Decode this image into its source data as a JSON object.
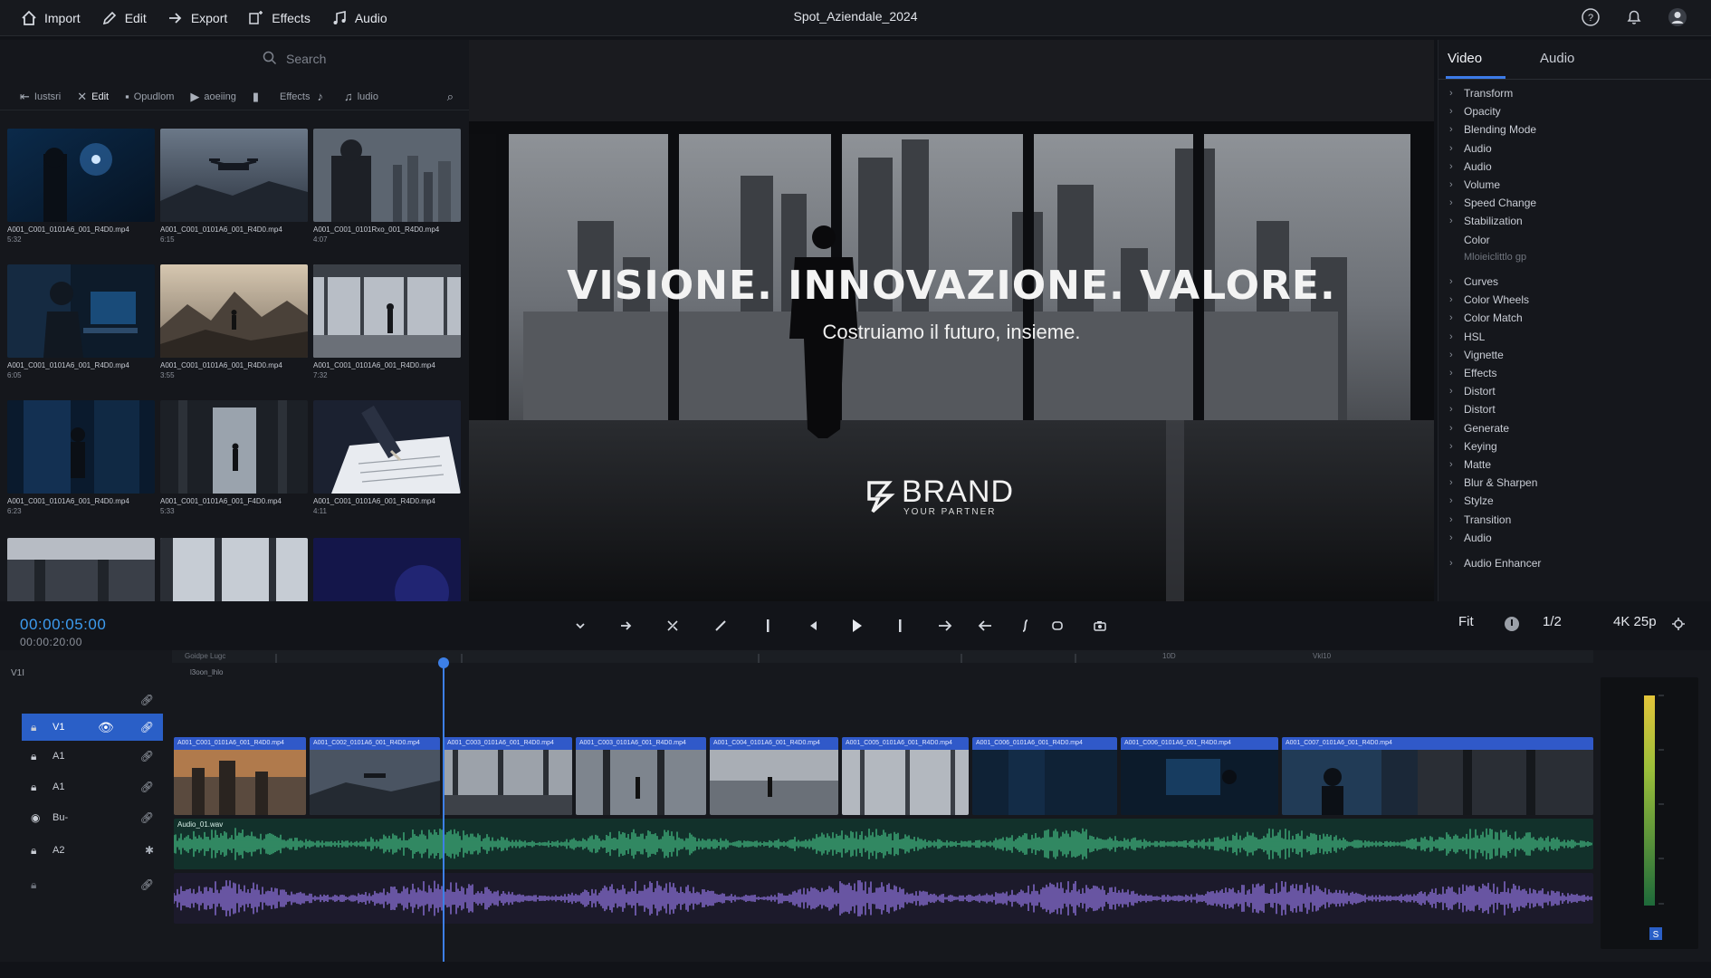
{
  "topbar": {
    "menu": [
      {
        "label": "Import",
        "icon": "home-icon"
      },
      {
        "label": "Edit",
        "icon": "pencil-icon"
      },
      {
        "label": "Export",
        "icon": "arrow-right-icon"
      },
      {
        "label": "Effects",
        "icon": "effects-icon"
      },
      {
        "label": "Audio",
        "icon": "music-note-icon"
      }
    ],
    "project_title": "Spot_Aziendale_2024",
    "right_icons": [
      "help-icon",
      "bell-icon",
      "user-avatar-icon"
    ]
  },
  "media": {
    "search_placeholder": "Search",
    "tools": [
      {
        "label": "Iustsri",
        "icon": "import-icon"
      },
      {
        "label": "Edit",
        "icon": "cut-icon"
      },
      {
        "label": "Opudlom",
        "icon": "clip-icon"
      },
      {
        "label": "aoeiing",
        "icon": "play-icon"
      },
      {
        "label": "",
        "icon": "film-icon"
      },
      {
        "label": "Effects",
        "icon": "effects-icon"
      },
      {
        "label": "ludio",
        "icon": "audio-icon"
      }
    ],
    "clips": [
      {
        "name": "A001_C001_0101A6_001_R4D0.mp4",
        "duration": "5:32"
      },
      {
        "name": "A001_C001_0101A6_001_R4D0.mp4",
        "duration": "6:15"
      },
      {
        "name": "A001_C001_0101Rxo_001_R4D0.mp4",
        "duration": "4:07"
      },
      {
        "name": "A001_C001_0101A6_001_R4D0.mp4",
        "duration": "6:05"
      },
      {
        "name": "A001_C001_0101A6_001_R4D0.mp4",
        "duration": "3:55"
      },
      {
        "name": "A001_C001_0101A6_001_R4D0.mp4",
        "duration": "7:32"
      },
      {
        "name": "A001_C001_0101A6_001_R4D0.mp4",
        "duration": "6:23"
      },
      {
        "name": "A001_C001_0101A6_001_F4D0.mp4",
        "duration": "5:33"
      },
      {
        "name": "A001_C001_0101A6_001_R4D0.mp4",
        "duration": "4:11"
      }
    ]
  },
  "viewer": {
    "headline": "VISIONE. INNOVAZIONE. VALORE.",
    "tagline": "Costruiamo il futuro, insieme.",
    "brand_name": "BRAND",
    "brand_sub": "YOUR PARTNER"
  },
  "inspector": {
    "tabs": [
      "Video",
      "Audio"
    ],
    "items": [
      {
        "label": "Transform",
        "chev": true
      },
      {
        "label": "Opacity",
        "chev": true
      },
      {
        "label": "Blending Mode",
        "chev": true
      },
      {
        "label": "Audio",
        "chev": true
      },
      {
        "label": "Audio",
        "chev": true
      },
      {
        "label": "Volume",
        "chev": true
      },
      {
        "label": "Speed Change",
        "chev": true
      },
      {
        "label": "Stabilization",
        "chev": true
      },
      {
        "label": "Color",
        "chev": false
      },
      {
        "label": "Mloieiclittlo gp",
        "chev": false,
        "faint": true
      },
      {
        "label": "Curves",
        "chev": true
      },
      {
        "label": "Color Wheels",
        "chev": true
      },
      {
        "label": "Color Match",
        "chev": true
      },
      {
        "label": "HSL",
        "chev": true
      },
      {
        "label": "Vignette",
        "chev": true
      },
      {
        "label": "Effects",
        "chev": true
      },
      {
        "label": "Distort",
        "chev": true
      },
      {
        "label": "Distort",
        "chev": true
      },
      {
        "label": "Generate",
        "chev": true
      },
      {
        "label": "Keying",
        "chev": true
      },
      {
        "label": "Matte",
        "chev": true
      },
      {
        "label": "Blur & Sharpen",
        "chev": true
      },
      {
        "label": "Stylze",
        "chev": true
      },
      {
        "label": "Transition",
        "chev": true
      },
      {
        "label": "Audio",
        "chev": true
      },
      {
        "label": "Audio Enhancer",
        "chev": true
      }
    ]
  },
  "transport": {
    "timecode": "00:00:05:00",
    "duration": "00:00:20:00",
    "fit": "Fit",
    "page": "1/2",
    "resolution": "4K 25p"
  },
  "timeline": {
    "ruler_labels": [
      "Goidpe Lugc",
      "10D",
      "Vkl10"
    ],
    "marker_label": "l3oon_lhlo",
    "track_header_label": "V1I",
    "tracks": [
      {
        "label": "",
        "lock": false
      },
      {
        "label": "V1",
        "lock": true,
        "selected": true
      },
      {
        "label": "A1",
        "lock": true
      },
      {
        "label": "A1",
        "lock": true
      },
      {
        "label": "Bu-",
        "lock": false
      },
      {
        "label": "A2",
        "lock": true
      },
      {
        "label": "",
        "lock": true
      }
    ],
    "video_clips": [
      "A001_C001_0101A6_001_R4D0.mp4",
      "A001_C002_0101A6_001_R4D0.mp4",
      "A001_C003_0101A6_001_R4D0.mp4",
      "A001_C003_0101A6_001_R4D0.mp4",
      "A001_C004_0101A6_001_R4D0.mp4",
      "A001_C005_0101A6_001_R4D0.mp4",
      "A001_C006_0101A6_001_R4D0.mp4",
      "A001_C006_0101A6_001_R4D0.mp4",
      "A001_C007_0101A6_001_R4D0.mp4"
    ],
    "audio1_label": "Audio_01.wav",
    "colors": {
      "accent": "#3d7fe6",
      "clip_bar": "#3059c9",
      "audio1": "#3fae7a",
      "audio2": "#8a6fd6",
      "timecode": "#3d9cf0"
    }
  }
}
